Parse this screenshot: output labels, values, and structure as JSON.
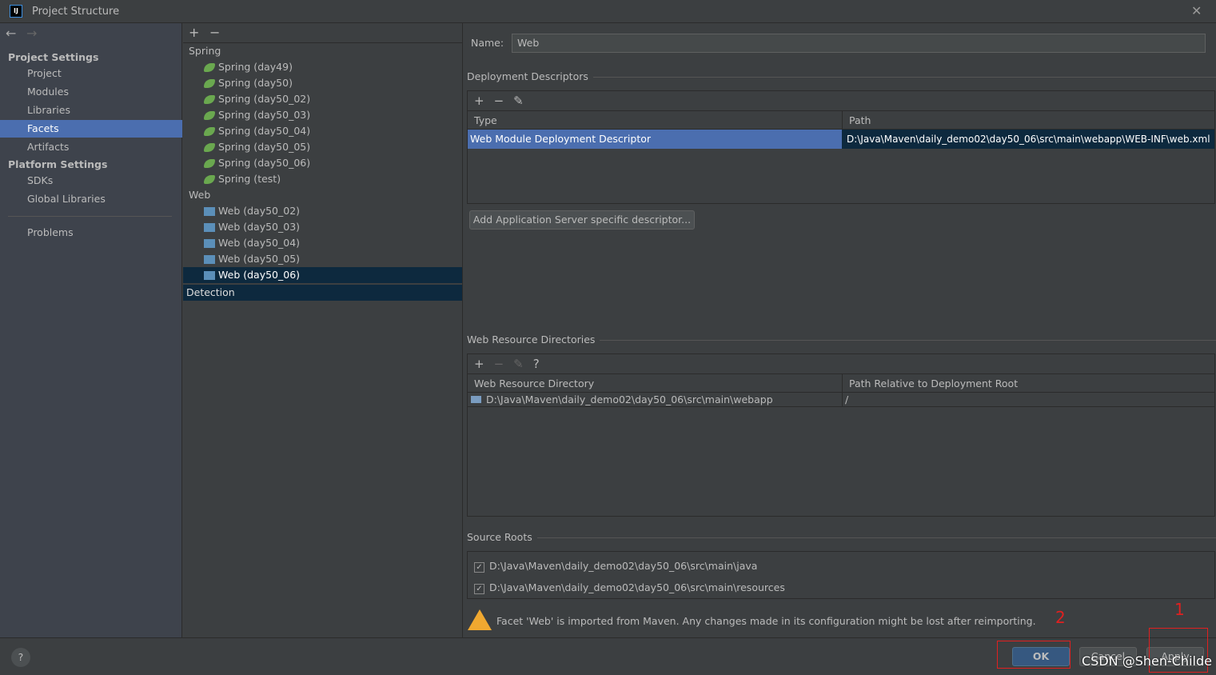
{
  "window": {
    "title": "Project Structure",
    "logo": "IJ"
  },
  "sidebar": {
    "back": "←",
    "forward": "→",
    "project_settings": "Project Settings",
    "platform_settings": "Platform Settings",
    "project_items": [
      "Project",
      "Modules",
      "Libraries",
      "Facets",
      "Artifacts"
    ],
    "platform_items": [
      "SDKs",
      "Global Libraries"
    ],
    "problems": "Problems",
    "selected": "Facets"
  },
  "tree": {
    "add": "+",
    "remove": "−",
    "groups": [
      {
        "label": "Spring",
        "items": [
          "Spring (day49)",
          "Spring (day50)",
          "Spring (day50_02)",
          "Spring (day50_03)",
          "Spring (day50_04)",
          "Spring (day50_05)",
          "Spring (day50_06)",
          "Spring (test)"
        ]
      },
      {
        "label": "Web",
        "items": [
          "Web (day50_02)",
          "Web (day50_03)",
          "Web (day50_04)",
          "Web (day50_05)",
          "Web (day50_06)"
        ]
      }
    ],
    "selected": "Web (day50_06)",
    "detection": "Detection"
  },
  "facet": {
    "name_label": "Name:",
    "name_value": "Web",
    "deployment": {
      "title": "Deployment Descriptors",
      "columns": [
        "Type",
        "Path"
      ],
      "rows": [
        [
          "Web Module Deployment Descriptor",
          "D:\\Java\\Maven\\daily_demo02\\day50_06\\src\\main\\webapp\\WEB-INF\\web.xml"
        ]
      ],
      "add_server_btn": "Add Application Server specific descriptor..."
    },
    "resources": {
      "title": "Web Resource Directories",
      "help": "?",
      "columns": [
        "Web Resource Directory",
        "Path Relative to Deployment Root"
      ],
      "rows": [
        [
          "D:\\Java\\Maven\\daily_demo02\\day50_06\\src\\main\\webapp",
          "/"
        ]
      ]
    },
    "source_roots": {
      "title": "Source Roots",
      "items": [
        {
          "path": "D:\\Java\\Maven\\daily_demo02\\day50_06\\src\\main\\java",
          "checked": true
        },
        {
          "path": "D:\\Java\\Maven\\daily_demo02\\day50_06\\src\\main\\resources",
          "checked": true
        }
      ]
    },
    "warning": "Facet 'Web' is imported from Maven. Any changes made in its configuration might be lost after reimporting."
  },
  "buttons": {
    "help": "?",
    "ok": "OK",
    "cancel": "Cancel",
    "apply": "Apply"
  },
  "annotations": {
    "n1": "1",
    "n2": "2",
    "watermark": "CSDN @Shen-Childe"
  },
  "colors": {
    "selection": "#4b6eaf",
    "ok": "#365880",
    "annotation": "#e02020"
  }
}
